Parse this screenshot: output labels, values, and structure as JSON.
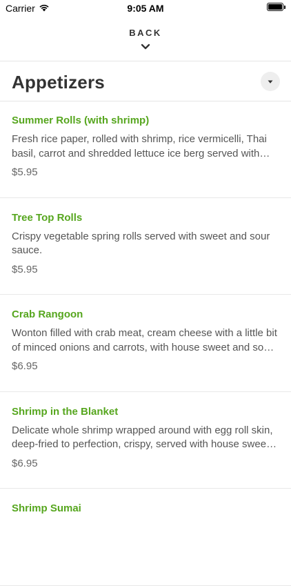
{
  "status_bar": {
    "carrier": "Carrier",
    "time": "9:05 AM",
    "battery_icon": "battery-full-icon",
    "wifi_icon": "wifi-icon"
  },
  "header": {
    "back_label": "BACK",
    "back_icon": "chevron-down-icon"
  },
  "section": {
    "title": "Appetizers",
    "toggle_icon": "caret-down-icon"
  },
  "menu_items": [
    {
      "name": "Summer Rolls (with shrimp)",
      "description": "Fresh rice paper, rolled with shrimp, rice vermicelli, Thai basil, carrot and shredded lettuce ice berg served with house peanut sauce.",
      "price": "$5.95"
    },
    {
      "name": "Tree Top Rolls",
      "description": "Crispy vegetable spring rolls served with sweet and sour sauce.",
      "price": "$5.95"
    },
    {
      "name": "Crab Rangoon",
      "description": "Wonton filled with crab meat, cream cheese with a little bit of minced onions and carrots, with house sweet and sour sauce.",
      "price": "$6.95"
    },
    {
      "name": "Shrimp in the Blanket",
      "description": "Delicate whole shrimp wrapped around with egg roll skin, deep-fried to perfection, crispy, served with house sweet and sour sauce.",
      "price": "$6.95"
    },
    {
      "name": "Shrimp Sumai",
      "description": "",
      "price": ""
    }
  ],
  "colors": {
    "item_name": "#56a61e",
    "divider": "#e5e5e5"
  }
}
